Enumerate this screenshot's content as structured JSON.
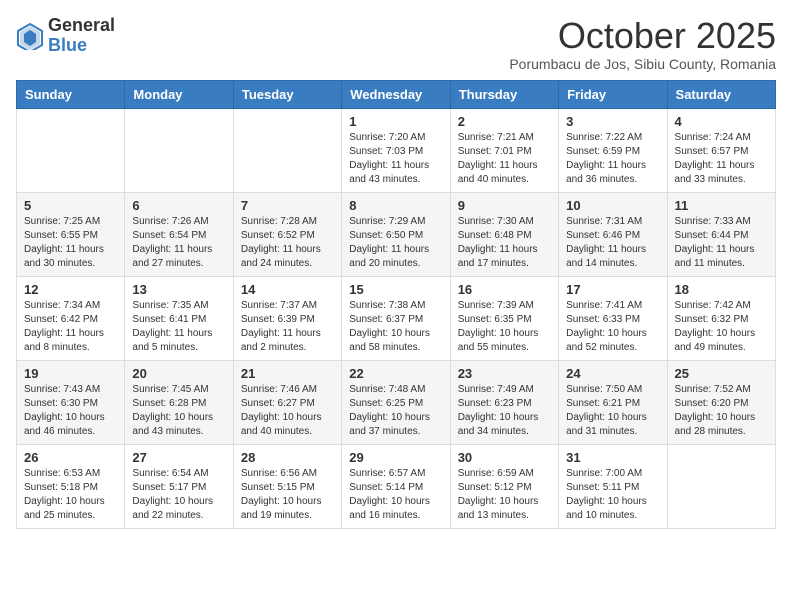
{
  "logo": {
    "general": "General",
    "blue": "Blue"
  },
  "header": {
    "month": "October 2025",
    "location": "Porumbacu de Jos, Sibiu County, Romania"
  },
  "days_of_week": [
    "Sunday",
    "Monday",
    "Tuesday",
    "Wednesday",
    "Thursday",
    "Friday",
    "Saturday"
  ],
  "weeks": [
    [
      {
        "day": "",
        "info": ""
      },
      {
        "day": "",
        "info": ""
      },
      {
        "day": "",
        "info": ""
      },
      {
        "day": "1",
        "info": "Sunrise: 7:20 AM\nSunset: 7:03 PM\nDaylight: 11 hours\nand 43 minutes."
      },
      {
        "day": "2",
        "info": "Sunrise: 7:21 AM\nSunset: 7:01 PM\nDaylight: 11 hours\nand 40 minutes."
      },
      {
        "day": "3",
        "info": "Sunrise: 7:22 AM\nSunset: 6:59 PM\nDaylight: 11 hours\nand 36 minutes."
      },
      {
        "day": "4",
        "info": "Sunrise: 7:24 AM\nSunset: 6:57 PM\nDaylight: 11 hours\nand 33 minutes."
      }
    ],
    [
      {
        "day": "5",
        "info": "Sunrise: 7:25 AM\nSunset: 6:55 PM\nDaylight: 11 hours\nand 30 minutes."
      },
      {
        "day": "6",
        "info": "Sunrise: 7:26 AM\nSunset: 6:54 PM\nDaylight: 11 hours\nand 27 minutes."
      },
      {
        "day": "7",
        "info": "Sunrise: 7:28 AM\nSunset: 6:52 PM\nDaylight: 11 hours\nand 24 minutes."
      },
      {
        "day": "8",
        "info": "Sunrise: 7:29 AM\nSunset: 6:50 PM\nDaylight: 11 hours\nand 20 minutes."
      },
      {
        "day": "9",
        "info": "Sunrise: 7:30 AM\nSunset: 6:48 PM\nDaylight: 11 hours\nand 17 minutes."
      },
      {
        "day": "10",
        "info": "Sunrise: 7:31 AM\nSunset: 6:46 PM\nDaylight: 11 hours\nand 14 minutes."
      },
      {
        "day": "11",
        "info": "Sunrise: 7:33 AM\nSunset: 6:44 PM\nDaylight: 11 hours\nand 11 minutes."
      }
    ],
    [
      {
        "day": "12",
        "info": "Sunrise: 7:34 AM\nSunset: 6:42 PM\nDaylight: 11 hours\nand 8 minutes."
      },
      {
        "day": "13",
        "info": "Sunrise: 7:35 AM\nSunset: 6:41 PM\nDaylight: 11 hours\nand 5 minutes."
      },
      {
        "day": "14",
        "info": "Sunrise: 7:37 AM\nSunset: 6:39 PM\nDaylight: 11 hours\nand 2 minutes."
      },
      {
        "day": "15",
        "info": "Sunrise: 7:38 AM\nSunset: 6:37 PM\nDaylight: 10 hours\nand 58 minutes."
      },
      {
        "day": "16",
        "info": "Sunrise: 7:39 AM\nSunset: 6:35 PM\nDaylight: 10 hours\nand 55 minutes."
      },
      {
        "day": "17",
        "info": "Sunrise: 7:41 AM\nSunset: 6:33 PM\nDaylight: 10 hours\nand 52 minutes."
      },
      {
        "day": "18",
        "info": "Sunrise: 7:42 AM\nSunset: 6:32 PM\nDaylight: 10 hours\nand 49 minutes."
      }
    ],
    [
      {
        "day": "19",
        "info": "Sunrise: 7:43 AM\nSunset: 6:30 PM\nDaylight: 10 hours\nand 46 minutes."
      },
      {
        "day": "20",
        "info": "Sunrise: 7:45 AM\nSunset: 6:28 PM\nDaylight: 10 hours\nand 43 minutes."
      },
      {
        "day": "21",
        "info": "Sunrise: 7:46 AM\nSunset: 6:27 PM\nDaylight: 10 hours\nand 40 minutes."
      },
      {
        "day": "22",
        "info": "Sunrise: 7:48 AM\nSunset: 6:25 PM\nDaylight: 10 hours\nand 37 minutes."
      },
      {
        "day": "23",
        "info": "Sunrise: 7:49 AM\nSunset: 6:23 PM\nDaylight: 10 hours\nand 34 minutes."
      },
      {
        "day": "24",
        "info": "Sunrise: 7:50 AM\nSunset: 6:21 PM\nDaylight: 10 hours\nand 31 minutes."
      },
      {
        "day": "25",
        "info": "Sunrise: 7:52 AM\nSunset: 6:20 PM\nDaylight: 10 hours\nand 28 minutes."
      }
    ],
    [
      {
        "day": "26",
        "info": "Sunrise: 6:53 AM\nSunset: 5:18 PM\nDaylight: 10 hours\nand 25 minutes."
      },
      {
        "day": "27",
        "info": "Sunrise: 6:54 AM\nSunset: 5:17 PM\nDaylight: 10 hours\nand 22 minutes."
      },
      {
        "day": "28",
        "info": "Sunrise: 6:56 AM\nSunset: 5:15 PM\nDaylight: 10 hours\nand 19 minutes."
      },
      {
        "day": "29",
        "info": "Sunrise: 6:57 AM\nSunset: 5:14 PM\nDaylight: 10 hours\nand 16 minutes."
      },
      {
        "day": "30",
        "info": "Sunrise: 6:59 AM\nSunset: 5:12 PM\nDaylight: 10 hours\nand 13 minutes."
      },
      {
        "day": "31",
        "info": "Sunrise: 7:00 AM\nSunset: 5:11 PM\nDaylight: 10 hours\nand 10 minutes."
      },
      {
        "day": "",
        "info": ""
      }
    ]
  ]
}
